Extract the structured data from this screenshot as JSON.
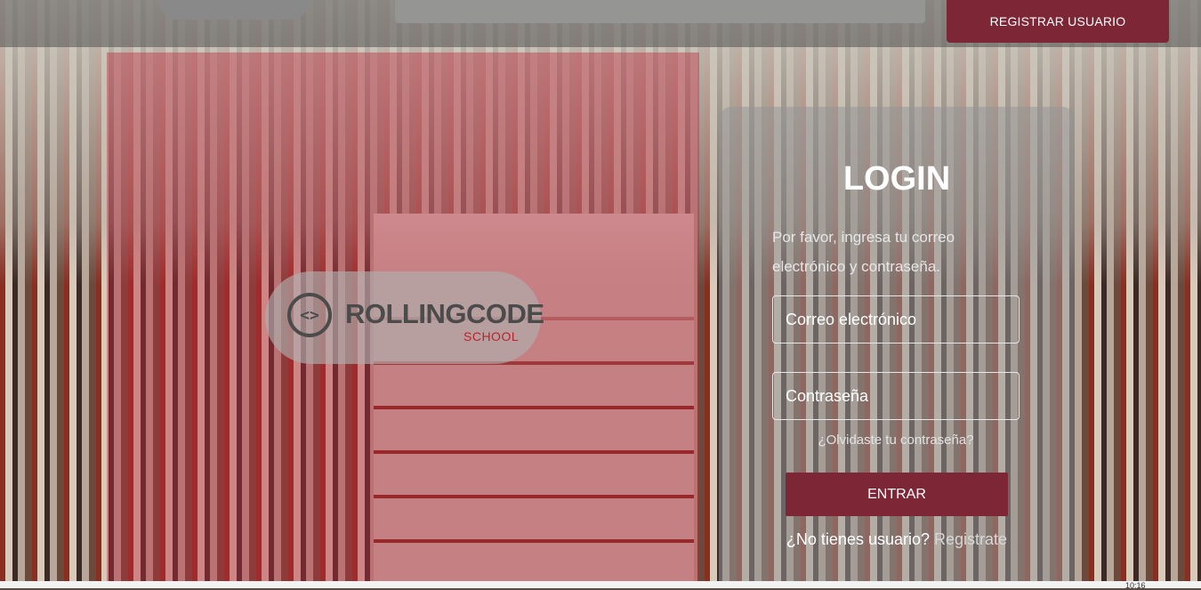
{
  "header": {
    "register_button": "REGISTRAR USUARIO"
  },
  "logo": {
    "symbol": "<>",
    "name": "ROLLINGCODE",
    "subtitle": "SCHOOL"
  },
  "login": {
    "title": "LOGIN",
    "description": "Por favor, ingresa tu correo electrónico y contraseña.",
    "email_placeholder": "Correo electrónico",
    "password_placeholder": "Contraseña",
    "forgot_link": "¿Olvidaste tu contraseña?",
    "submit_label": "ENTRAR",
    "no_account_text": "¿No tienes usuario?",
    "register_link": "Registrate"
  },
  "taskbar": {
    "clock": "10:16"
  },
  "colors": {
    "accent": "#7d2736",
    "panel_overlay": "#be283c"
  }
}
